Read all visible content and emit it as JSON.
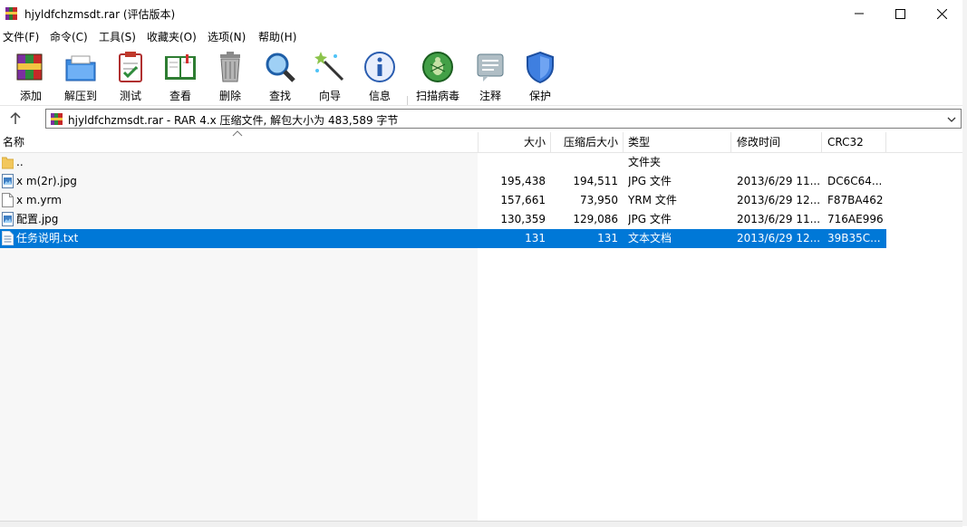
{
  "window": {
    "title": "hjyldfchzmsdt.rar (评估版本)"
  },
  "menu": [
    "文件(F)",
    "命令(C)",
    "工具(S)",
    "收藏夹(O)",
    "选项(N)",
    "帮助(H)"
  ],
  "toolbar": [
    {
      "label": "添加",
      "icon": "add-archive-icon"
    },
    {
      "label": "解压到",
      "icon": "extract-to-icon"
    },
    {
      "label": "测试",
      "icon": "test-icon"
    },
    {
      "label": "查看",
      "icon": "view-book-icon"
    },
    {
      "label": "删除",
      "icon": "trash-icon"
    },
    {
      "label": "查找",
      "icon": "magnifier-icon"
    },
    {
      "label": "向导",
      "icon": "wizard-wand-icon"
    },
    {
      "label": "信息",
      "icon": "info-icon"
    },
    {
      "label": "扫描病毒",
      "icon": "virus-scan-icon"
    },
    {
      "label": "注释",
      "icon": "comment-icon"
    },
    {
      "label": "保护",
      "icon": "shield-icon"
    }
  ],
  "address": {
    "text": "hjyldfchzmsdt.rar - RAR 4.x 压缩文件, 解包大小为 483,589 字节"
  },
  "columns": {
    "name": "名称",
    "size": "大小",
    "packed": "压缩后大小",
    "type": "类型",
    "modified": "修改时间",
    "crc": "CRC32"
  },
  "files": [
    {
      "name": "..",
      "size": "",
      "packed": "",
      "type": "文件夹",
      "modified": "",
      "crc": "",
      "icon": "folder-icon",
      "selected": false
    },
    {
      "name": "x m(2r).jpg",
      "size": "195,438",
      "packed": "194,511",
      "type": "JPG 文件",
      "modified": "2013/6/29 11...",
      "crc": "DC6C64...",
      "icon": "image-file-icon",
      "selected": false
    },
    {
      "name": "x m.yrm",
      "size": "157,661",
      "packed": "73,950",
      "type": "YRM 文件",
      "modified": "2013/6/29 12...",
      "crc": "F87BA462",
      "icon": "blank-file-icon",
      "selected": false
    },
    {
      "name": "配置.jpg",
      "size": "130,359",
      "packed": "129,086",
      "type": "JPG 文件",
      "modified": "2013/6/29 11...",
      "crc": "716AE996",
      "icon": "image-file-icon",
      "selected": false
    },
    {
      "name": "任务说明.txt",
      "size": "131",
      "packed": "131",
      "type": "文本文档",
      "modified": "2013/6/29 12...",
      "crc": "39B35C...",
      "icon": "text-file-icon",
      "selected": true
    }
  ]
}
